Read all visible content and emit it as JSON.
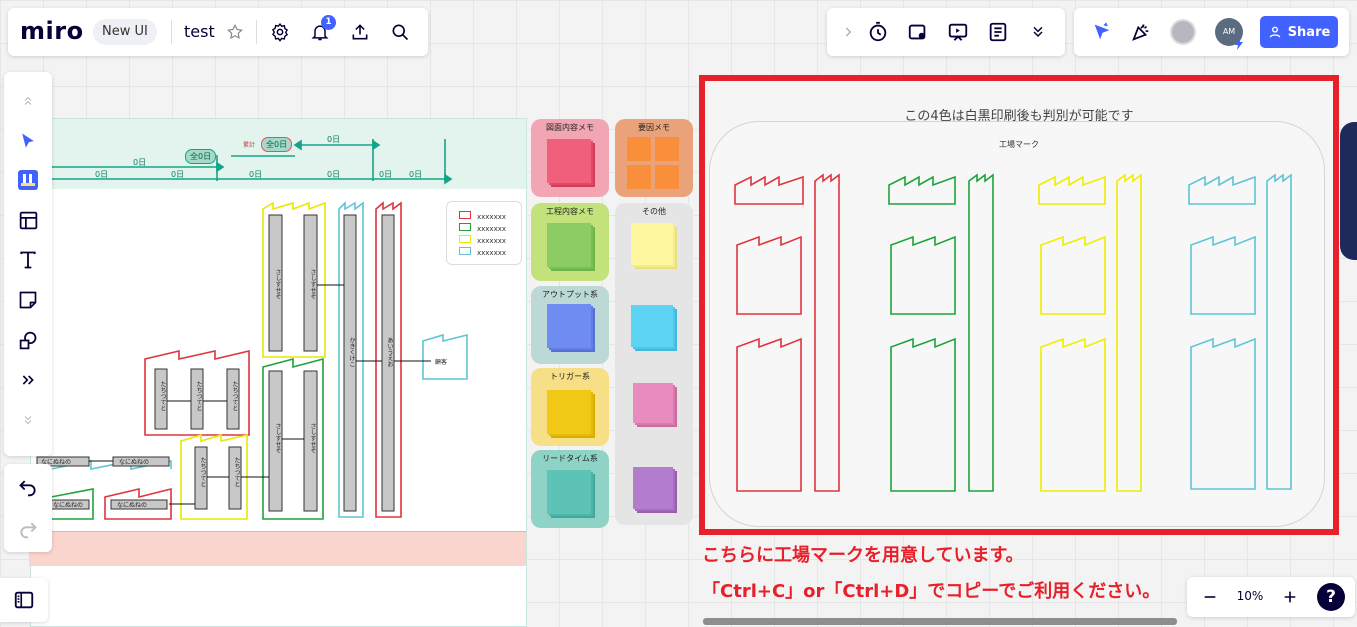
{
  "app": {
    "logo": "miro",
    "badge": "New UI",
    "board_name": "test",
    "notification_count": "1"
  },
  "toolbar_right": {
    "share_label": "Share",
    "avatar_initials": "AM"
  },
  "zoom": {
    "value": "10%"
  },
  "board": {
    "red_frame_title": "この4色は白黒印刷後も判別が可能です",
    "factory_heading": "工場マーク",
    "note_line1": "こちらに工場マークを用意しています。",
    "note_line2": "「Ctrl+C」or「Ctrl+D」でコピーでご利用ください。"
  },
  "palette": {
    "cards": [
      {
        "label": "図面内容メモ",
        "color": "#f2a6b3"
      },
      {
        "label": "要因メモ",
        "color": "#e9a27a"
      },
      {
        "label": "工程内容メモ",
        "color": "#c3e27b"
      },
      {
        "label": "その他",
        "color": "#e5e5e5"
      },
      {
        "label": "アウトプット系",
        "color": "#bcd9d6"
      },
      {
        "label": "トリガー系",
        "color": "#f6df86"
      },
      {
        "label": "リードタイム系",
        "color": "#8fd3c7"
      }
    ]
  },
  "flow": {
    "timeline_labels": [
      "0日",
      "0日",
      "0日",
      "0日",
      "0日",
      "0日",
      "0日",
      "0日"
    ],
    "timeline_pills": [
      "全0日",
      "全0日"
    ],
    "pill_caption": "累計",
    "legend_items": [
      "xxxxxxx",
      "xxxxxxx",
      "xxxxxxx",
      "xxxxxxx"
    ],
    "box_labels": [
      "さしすせそ",
      "さしすせそ",
      "かきくけこ",
      "あいうえお",
      "たちつてと",
      "たちつてと",
      "たちつてと",
      "さしすせそ",
      "さしすせそ",
      "たちつてと",
      "たちつてと"
    ],
    "row_labels": [
      "なにぬねの",
      "なにぬねの",
      "なにぬねの",
      "なにぬねの"
    ],
    "customer_label": "顧客"
  }
}
